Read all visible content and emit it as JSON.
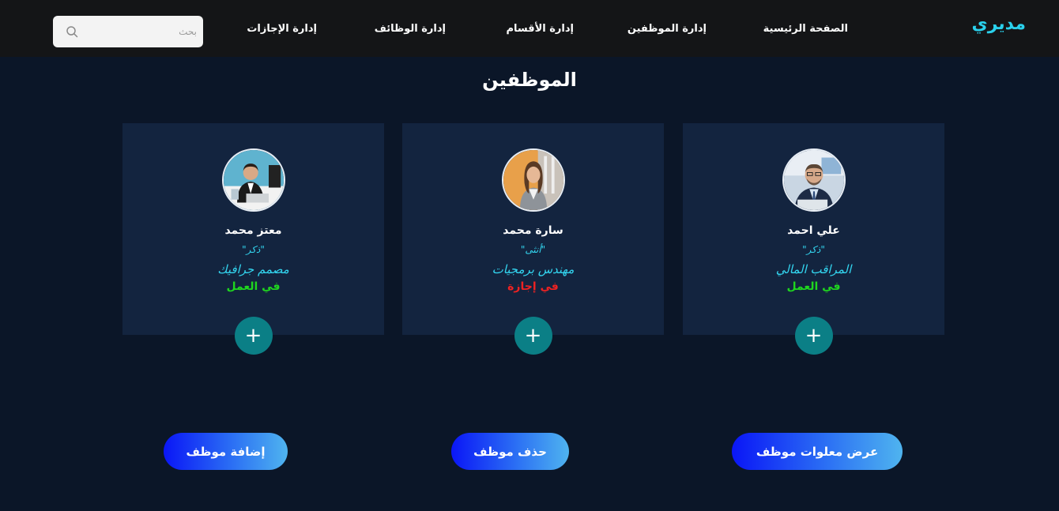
{
  "nav": {
    "brand": "مديري",
    "items": [
      "الصفحة الرئيسية",
      "إدارة الموظفين",
      "إدارة الأقسام",
      "إدارة الوظائف",
      "إدارة الإجازات"
    ],
    "search_placeholder": "بحث"
  },
  "main": {
    "title": "الموظفين"
  },
  "employees": [
    {
      "name": "علي احمد",
      "gender": "\"ذكر\"",
      "job": "المراقب المالي",
      "status": "في العمل",
      "status_color": "#1fd61f"
    },
    {
      "name": "سارة محمد",
      "gender": "\"أنثى\"",
      "job": "مهندس برمجيات",
      "status": "في إجازة",
      "status_color": "#ee2222"
    },
    {
      "name": "معتز محمد",
      "gender": "\"ذكر\"",
      "job": "مصمم جرافيك",
      "status": "في العمل",
      "status_color": "#1fd61f"
    }
  ],
  "card_add_symbol": "+",
  "actions": {
    "view": "عرض معلوات موظف",
    "delete": "حذف موظف",
    "add": "إضافة موظف"
  },
  "colors": {
    "background": "#0b1628",
    "navbar": "#141517",
    "card": "#13243f",
    "accent": "#2ad0ec",
    "add_circle": "#0b7f86"
  }
}
